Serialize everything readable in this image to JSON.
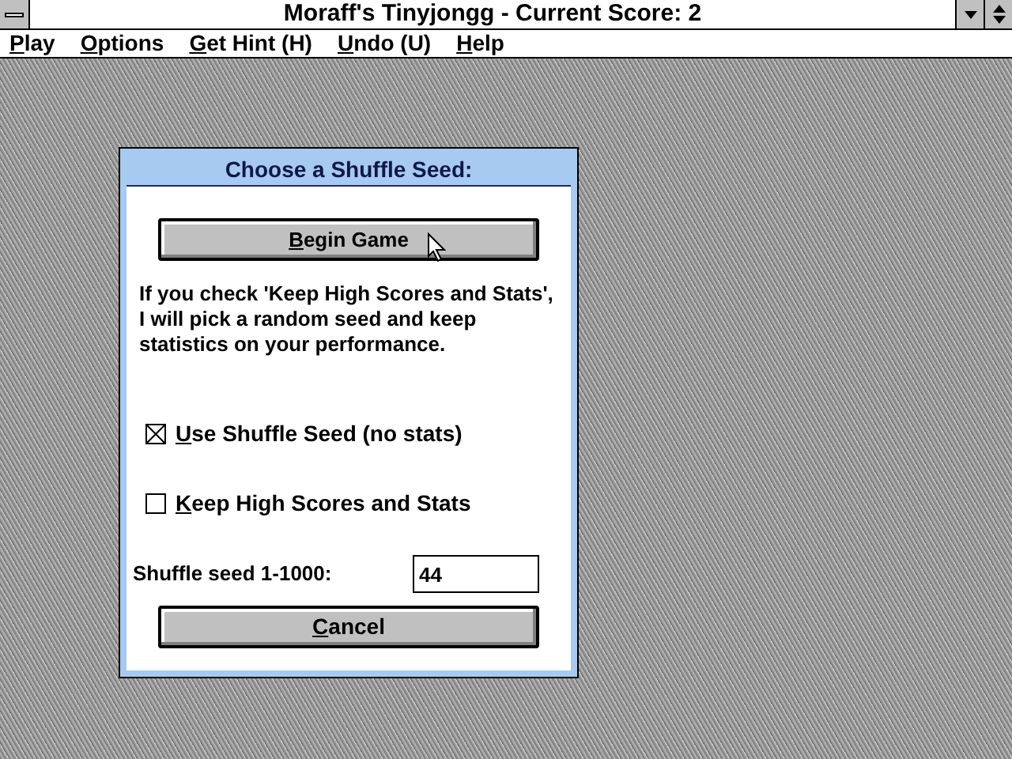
{
  "window": {
    "title": "Moraff's Tinyjongg - Current Score: 2"
  },
  "menu": [
    "Play",
    "Options",
    "Get Hint (H)",
    "Undo (U)",
    "Help"
  ],
  "dialog": {
    "title": "Choose a Shuffle Seed:",
    "begin_button": "Begin Game",
    "message": "If you check 'Keep High Scores and Stats', I will pick a random seed and keep statistics on your performance.",
    "options": [
      {
        "label": "Use Shuffle Seed (no stats)",
        "checked": true
      },
      {
        "label": "Keep High Scores and Stats",
        "checked": false
      }
    ],
    "seed_label": "Shuffle seed 1-1000:",
    "seed_value": "44",
    "cancel_button": "Cancel"
  }
}
